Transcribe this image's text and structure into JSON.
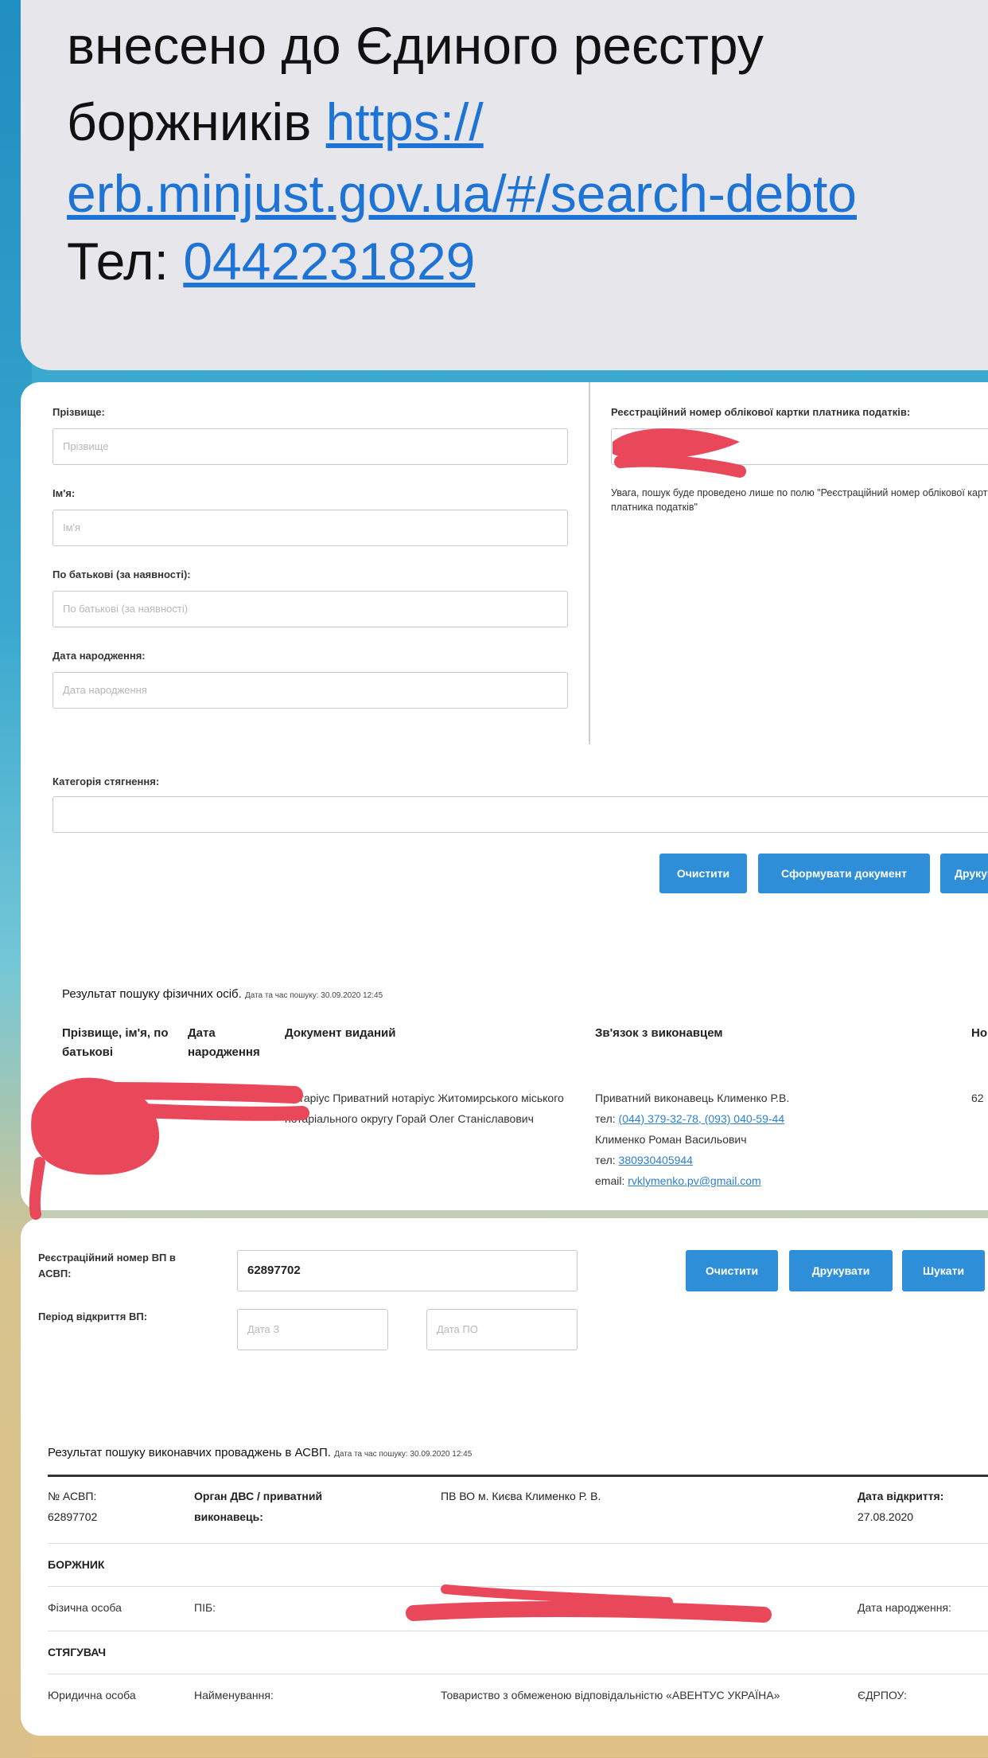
{
  "message": {
    "line1": "внесено до Єдиного реєстру",
    "line2_text": "боржників ",
    "line2_link": "https://",
    "line3_link": "erb.minjust.gov.ua/#/search-debto",
    "line4_text": "Тел: ",
    "line4_link": "0442231829"
  },
  "search_form": {
    "surname_label": "Прізвище:",
    "surname_placeholder": "Прізвище",
    "name_label": "Ім'я:",
    "name_placeholder": "Ім'я",
    "patronymic_label": "По батькові (за наявності):",
    "patronymic_placeholder": "По батькові (за наявності)",
    "birthdate_label": "Дата народження:",
    "birthdate_placeholder": "Дата народження",
    "tax_label": "Реєстраційний номер облікової картки платника податків:",
    "tax_note": "Увага, пошук буде проведено лише по полю \"Реєстраційний номер облікової картки платника податків\"",
    "category_label": "Категорія стягнення:",
    "clear_button": "Очистити",
    "generate_button": "Сформувати документ",
    "print_button": "Друкувати"
  },
  "persons_result": {
    "caption": "Результат пошуку фізичних осіб.",
    "caption_small": "Дата та час пошуку: 30.09.2020 12:45",
    "headers": [
      "Прізвище, ім'я, по батькові",
      "Дата народження",
      "Документ виданий",
      "Зв'язок з виконавцем",
      "Но"
    ],
    "document_issued": "Нотаріус Приватний нотаріус Житомирського міського нотаріального округу Горай Олег Станіславович",
    "contact": {
      "line1": "Приватний виконавець Клименко Р.В.",
      "phone1_prefix": "тел: ",
      "phone1": "(044) 379-32-78, (093) 040-59-44",
      "line3": "Клименко Роман Васильович",
      "phone2_prefix": "тел: ",
      "phone2": "380930405944",
      "email_prefix": "email: ",
      "email": "rvklymenko.pv@gmail.com"
    },
    "number_partial": "62"
  },
  "asvp_form": {
    "reg_label": "Реєстраційний номер ВП в АСВП:",
    "reg_value": "62897702",
    "period_label": "Період відкриття ВП:",
    "date_from_placeholder": "Дата З",
    "date_to_placeholder": "Дата ПО",
    "clear_button": "Очистити",
    "print_button": "Друкувати",
    "search_button": "Шукати"
  },
  "asvp_result": {
    "caption": "Результат пошуку виконавчих проваджень в АСВП.",
    "caption_small": "Дата та час пошуку: 30.09.2020 12:45",
    "asvp_no_label": "№ АСВП:",
    "asvp_no_value": "62897702",
    "organ_label": "Орган ДВС / приватний виконавець:",
    "organ_value": "ПВ ВО м. Києва Клименко Р. В.",
    "open_date_label": "Дата відкриття:",
    "open_date_value": "27.08.2020",
    "debtor_heading": "БОРЖНИК",
    "debtor_type": "Фізична особа",
    "debtor_name_label": "ПІБ:",
    "debtor_birth_label": "Дата народження:",
    "creditor_heading": "СТЯГУВАЧ",
    "creditor_type": "Юридична особа",
    "creditor_name_label": "Найменування:",
    "creditor_name_value": "Товариство з обмеженою відповідальністю «АВЕНТУС УКРАЇНА»",
    "creditor_code_label": "ЄДРПОУ:"
  },
  "colors": {
    "button_blue": "#2e8fd8",
    "link_blue": "#1e73d6",
    "redaction_red": "#e8485a"
  }
}
